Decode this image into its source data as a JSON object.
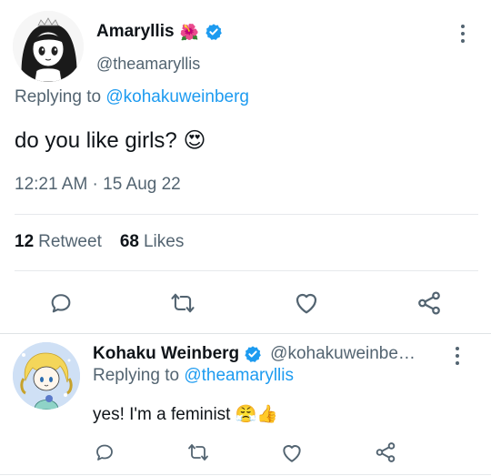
{
  "main_tweet": {
    "author_name": "Amaryllis",
    "author_emoji": "🌺",
    "author_handle": "@theamaryllis",
    "reply_prefix": "Replying to",
    "reply_to": "@kohakuweinberg",
    "text": "do you like girls?",
    "text_emoji": "😍",
    "timestamp": "12:21 AM · 15 Aug 22",
    "retweet_count": "12",
    "retweet_label": "Retweet",
    "likes_count": "68",
    "likes_label": "Likes"
  },
  "reply_tweet": {
    "author_name": "Kohaku Weinberg",
    "author_handle": "@kohakuweinbe…",
    "reply_prefix": "Replying to",
    "reply_to": "@theamaryllis",
    "text": "yes! I'm a feminist",
    "text_emojis": "😤👍"
  },
  "colors": {
    "accent": "#1d9bf0",
    "text": "#0f1419",
    "secondary": "#536471",
    "divider": "#e6e9ec"
  },
  "icons": [
    "reply-icon",
    "retweet-icon",
    "like-icon",
    "share-icon",
    "more-icon",
    "verified-badge-icon"
  ]
}
